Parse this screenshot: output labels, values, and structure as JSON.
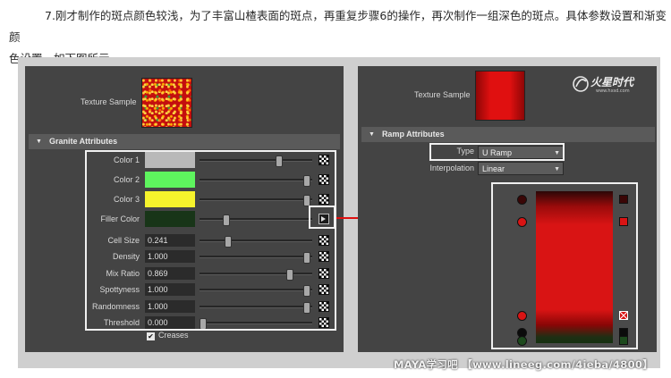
{
  "intro": {
    "line1": "7.刚才制作的斑点颜色较浅，为了丰富山楂表面的斑点，再重复步骤6的操作，再次制作一组深色的斑点。具体参数设置和渐变颜",
    "line2": "色设置，如下图所示。"
  },
  "left_panel": {
    "texture_sample_label": "Texture Sample",
    "section_title": "Granite Attributes",
    "color_rows": [
      {
        "label": "Color 1",
        "color": "#b9b9b9",
        "slider": 0.72
      },
      {
        "label": "Color 2",
        "color": "#5ef45e",
        "slider": 0.98
      },
      {
        "label": "Color 3",
        "color": "#f6f32c",
        "slider": 0.98
      },
      {
        "label": "Filler Color",
        "color": "#183518",
        "slider": 0.22
      }
    ],
    "numeric_rows": [
      {
        "label": "Cell Size",
        "value": "0.241",
        "slider": 0.24
      },
      {
        "label": "Density",
        "value": "1.000",
        "slider": 0.98
      },
      {
        "label": "Mix Ratio",
        "value": "0.869",
        "slider": 0.82
      },
      {
        "label": "Spottyness",
        "value": "1.000",
        "slider": 0.98
      },
      {
        "label": "Randomness",
        "value": "1.000",
        "slider": 0.98
      },
      {
        "label": "Threshold",
        "value": "0.000",
        "slider": 0.0
      }
    ],
    "creases_label": "Creases",
    "creases_checked": "✔"
  },
  "right_panel": {
    "texture_sample_label": "Texture Sample",
    "section_title": "Ramp Attributes",
    "type_label": "Type",
    "type_value": "U Ramp",
    "interpolation_label": "Interpolation",
    "interpolation_value": "Linear",
    "ramp_stops": [
      {
        "position": 0.05,
        "color": "#3a0606",
        "side_selected": false
      },
      {
        "position": 0.2,
        "color": "#d91414",
        "side_selected": false
      },
      {
        "position": 0.82,
        "color": "#d91414",
        "side_selected": true
      },
      {
        "position": 0.93,
        "color": "#0b0b0b",
        "side_selected": false
      },
      {
        "position": 0.98,
        "color": "#1d4a1d",
        "side_selected": false
      }
    ]
  },
  "logo_text": "火星时代",
  "logo_sub": "www.hxsd.com",
  "watermark": "MAYA学习吧 【www.lineeg.com/4ieba/4800】"
}
